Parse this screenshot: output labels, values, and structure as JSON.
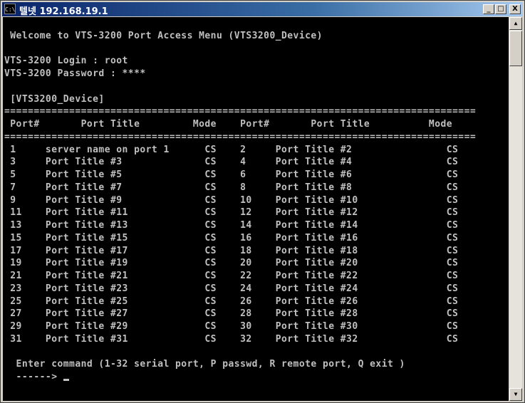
{
  "window": {
    "title": "텔넷 192.168.19.1",
    "icon_label": "C:\\",
    "buttons": {
      "minimize": "_",
      "maximize": "□",
      "close": "X"
    }
  },
  "terminal": {
    "lines": [
      "",
      " Welcome to VTS-3200 Port Access Menu (VTS3200_Device)",
      "",
      "VTS-3200 Login : root",
      "VTS-3200 Password : ****",
      "",
      " [VTS3200_Device]",
      "================================================================================",
      " Port#       Port Title         Mode    Port#       Port Title          Mode",
      "================================================================================",
      " 1     server name on port 1      CS    2     Port Title #2                CS",
      " 3     Port Title #3              CS    4     Port Title #4                CS",
      " 5     Port Title #5              CS    6     Port Title #6                CS",
      " 7     Port Title #7              CS    8     Port Title #8                CS",
      " 9     Port Title #9              CS    10    Port Title #10               CS",
      " 11    Port Title #11             CS    12    Port Title #12               CS",
      " 13    Port Title #13             CS    14    Port Title #14               CS",
      " 15    Port Title #15             CS    16    Port Title #16               CS",
      " 17    Port Title #17             CS    18    Port Title #18               CS",
      " 19    Port Title #19             CS    20    Port Title #20               CS",
      " 21    Port Title #21             CS    22    Port Title #22               CS",
      " 23    Port Title #23             CS    24    Port Title #24               CS",
      " 25    Port Title #25             CS    26    Port Title #26               CS",
      " 27    Port Title #27             CS    28    Port Title #28               CS",
      " 29    Port Title #29             CS    30    Port Title #30               CS",
      " 31    Port Title #31             CS    32    Port Title #32               CS",
      "",
      "  Enter command (1-32 serial port, P passwd, R remote port, Q exit )",
      "  ------> "
    ]
  },
  "scrollbar": {
    "up_arrow": "▲",
    "down_arrow": "▼"
  }
}
